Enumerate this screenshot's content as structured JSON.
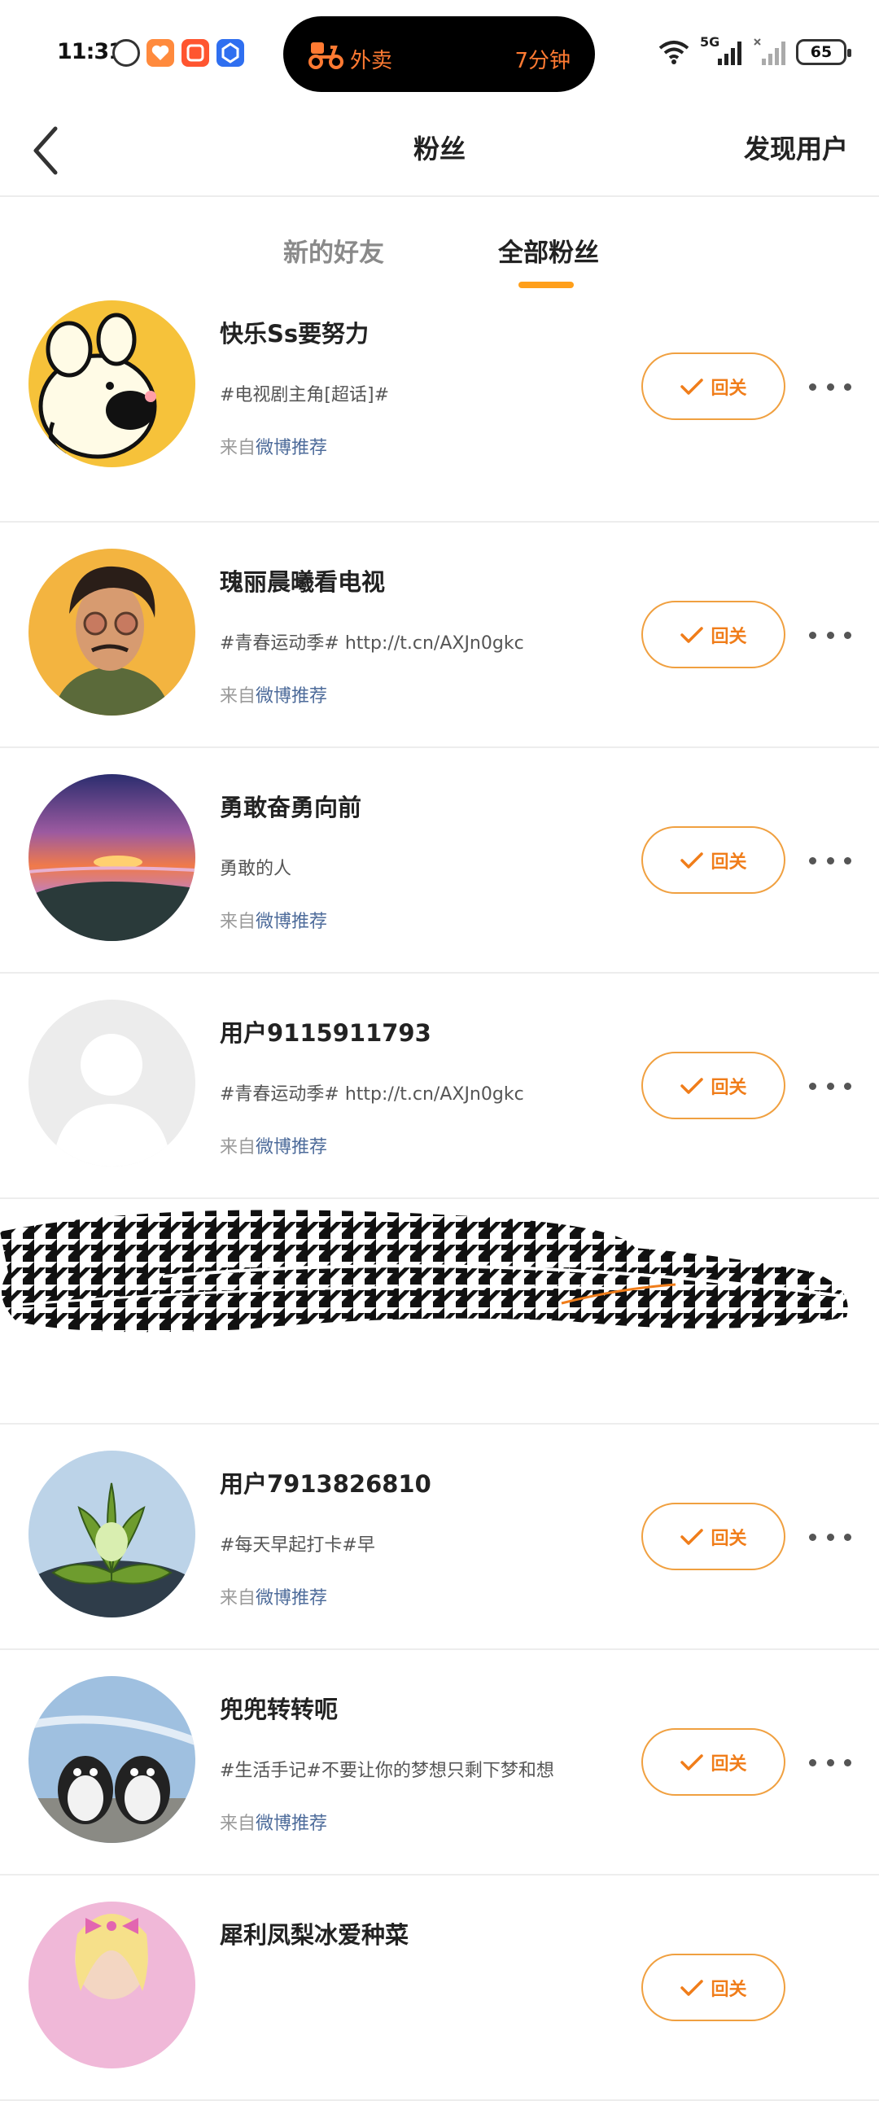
{
  "status_bar": {
    "time": "11:31",
    "island": {
      "label": "外卖",
      "time": "7分钟"
    },
    "network": "5G",
    "battery": "65"
  },
  "nav": {
    "title": "粉丝",
    "right_action": "发现用户"
  },
  "tabs": [
    {
      "label": "新的好友",
      "active": false
    },
    {
      "label": "全部粉丝",
      "active": true
    }
  ],
  "follow_label": "回关",
  "source_prefix": "来自",
  "source_link": "微博推荐",
  "fans": [
    {
      "name": "快乐Ss要努力",
      "desc": "#电视剧主角[超话]#"
    },
    {
      "name": "瑰丽晨曦看电视",
      "desc": "#青春运动季# http://t.cn/AXJn0gkc"
    },
    {
      "name": "勇敢奋勇向前",
      "desc": "勇敢的人"
    },
    {
      "name": "用户9115911793",
      "desc": "#青春运动季# http://t.cn/AXJn0gkc"
    },
    {
      "name": "用户7913826810",
      "desc": "#每天早起打卡#早"
    },
    {
      "name": "兜兜转转呃",
      "desc": "#生活手记#不要让你的梦想只剩下梦和想"
    },
    {
      "name": "犀利凤梨冰爱种菜",
      "desc": ""
    }
  ],
  "colors": {
    "accent": "#ff9f1a",
    "button_text": "#f07d1a",
    "link": "#4d6b9a"
  }
}
